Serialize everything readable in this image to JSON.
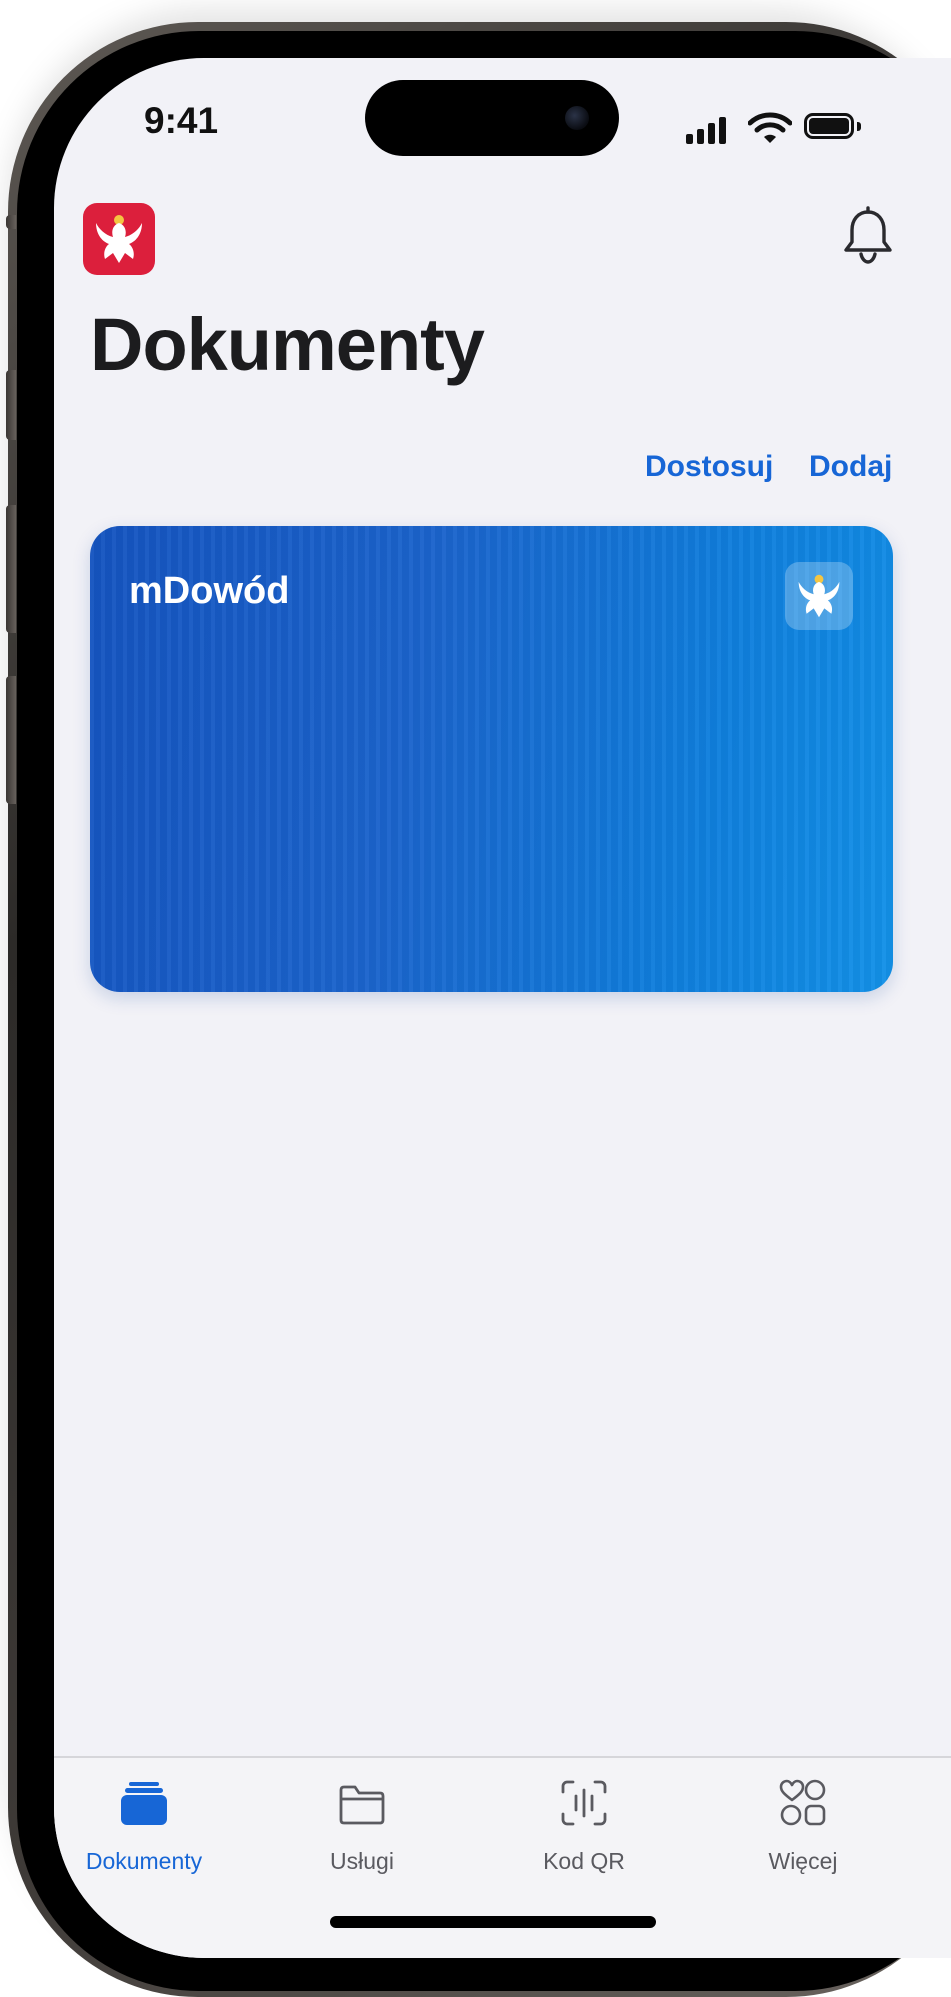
{
  "status_bar": {
    "time": "9:41",
    "icons": [
      "signal-icon",
      "wifi-icon",
      "battery-icon"
    ]
  },
  "header": {
    "logo_icon": "polish-eagle-icon",
    "notification_icon": "bell-icon",
    "title": "Dokumenty"
  },
  "actions": {
    "customize_label": "Dostosuj",
    "add_label": "Dodaj"
  },
  "card": {
    "title": "mDowód",
    "emblem_icon": "polish-eagle-icon",
    "gradient_from": "#1554c0",
    "gradient_to": "#1391e8"
  },
  "tabs": [
    {
      "label": "Dokumenty",
      "icon": "documents-stack-icon",
      "active": true
    },
    {
      "label": "Usługi",
      "icon": "folder-icon",
      "active": false
    },
    {
      "label": "Kod QR",
      "icon": "qr-scan-icon",
      "active": false
    },
    {
      "label": "Więcej",
      "icon": "more-grid-icon",
      "active": false
    }
  ],
  "colors": {
    "accent": "#1766d6",
    "logo_red": "#dc1f3c",
    "background": "#f2f2f7"
  }
}
